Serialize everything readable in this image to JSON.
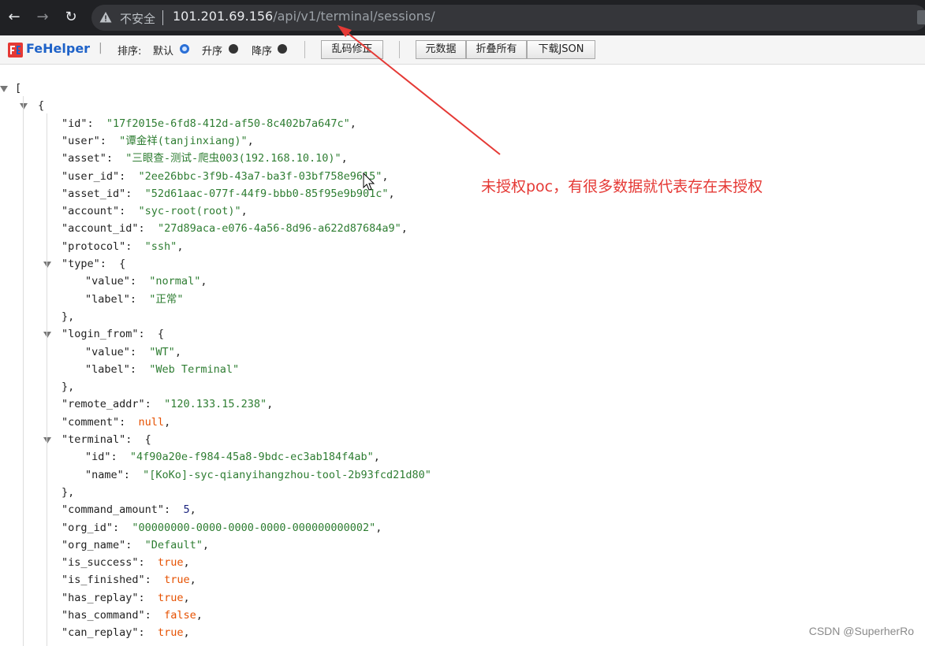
{
  "browser": {
    "back": "←",
    "forward": "→",
    "reload": "↻",
    "security_label": "不安全",
    "url_host": "101.201.69.156",
    "url_path": "/api/v1/terminal/sessions/"
  },
  "fehelper": {
    "brand": "FeHelper",
    "divider": "|",
    "sort_label": "排序:",
    "sort_options": [
      "默认",
      "升序",
      "降序"
    ],
    "selected_sort": "默认",
    "buttons": [
      "乱码修正",
      "元数据",
      "折叠所有",
      "下载JSON"
    ]
  },
  "json_lines": [
    {
      "t": "bracket",
      "text": "["
    },
    {
      "t": "brace",
      "text": "{"
    },
    {
      "key": "\"id\"",
      "val": "\"17f2015e-6fd8-412d-af50-8c402b7a647c\"",
      "type": "s"
    },
    {
      "key": "\"user\"",
      "val": "\"谭金祥(tanjinxiang)\"",
      "type": "s"
    },
    {
      "key": "\"asset\"",
      "val": "\"三眼查-测试-爬虫003(192.168.10.10)\"",
      "type": "s"
    },
    {
      "key": "\"user_id\"",
      "val": "\"2ee26bbc-3f9b-43a7-ba3f-03bf758e9615\"",
      "type": "s"
    },
    {
      "key": "\"asset_id\"",
      "val": "\"52d61aac-077f-44f9-bbb0-85f95e9b901c\"",
      "type": "s"
    },
    {
      "key": "\"account\"",
      "val": "\"syc-root(root)\"",
      "type": "s"
    },
    {
      "key": "\"account_id\"",
      "val": "\"27d89aca-e076-4a56-8d96-a622d87684a9\"",
      "type": "s"
    },
    {
      "key": "\"protocol\"",
      "val": "\"ssh\"",
      "type": "s"
    },
    {
      "key": "\"type\"",
      "open": true
    },
    {
      "key": "\"value\"",
      "val": "\"normal\"",
      "type": "s",
      "nested": true
    },
    {
      "key": "\"label\"",
      "val": "\"正常\"",
      "type": "s",
      "nested": true,
      "last": true
    },
    {
      "close": true
    },
    {
      "key": "\"login_from\"",
      "open": true
    },
    {
      "key": "\"value\"",
      "val": "\"WT\"",
      "type": "s",
      "nested": true
    },
    {
      "key": "\"label\"",
      "val": "\"Web Terminal\"",
      "type": "s",
      "nested": true,
      "last": true
    },
    {
      "close": true
    },
    {
      "key": "\"remote_addr\"",
      "val": "\"120.133.15.238\"",
      "type": "s"
    },
    {
      "key": "\"comment\"",
      "val": "null",
      "type": "b"
    },
    {
      "key": "\"terminal\"",
      "open": true
    },
    {
      "key": "\"id\"",
      "val": "\"4f90a20e-f984-45a8-9bdc-ec3ab184f4ab\"",
      "type": "s",
      "nested": true
    },
    {
      "key": "\"name\"",
      "val": "\"[KoKo]-syc-qianyihangzhou-tool-2b93fcd21d80\"",
      "type": "s",
      "nested": true,
      "last": true
    },
    {
      "close": true
    },
    {
      "key": "\"command_amount\"",
      "val": "5",
      "type": "n"
    },
    {
      "key": "\"org_id\"",
      "val": "\"00000000-0000-0000-0000-000000000002\"",
      "type": "s"
    },
    {
      "key": "\"org_name\"",
      "val": "\"Default\"",
      "type": "s"
    },
    {
      "key": "\"is_success\"",
      "val": "true",
      "type": "b"
    },
    {
      "key": "\"is_finished\"",
      "val": "true",
      "type": "b"
    },
    {
      "key": "\"has_replay\"",
      "val": "true",
      "type": "b"
    },
    {
      "key": "\"has_command\"",
      "val": "false",
      "type": "b"
    },
    {
      "key": "\"can_replay\"",
      "val": "true",
      "type": "b"
    }
  ],
  "annotation": "未授权poc，有很多数据就代表存在未授权",
  "annotation_color": "#e53935",
  "watermark": "CSDN @SuperherRo"
}
